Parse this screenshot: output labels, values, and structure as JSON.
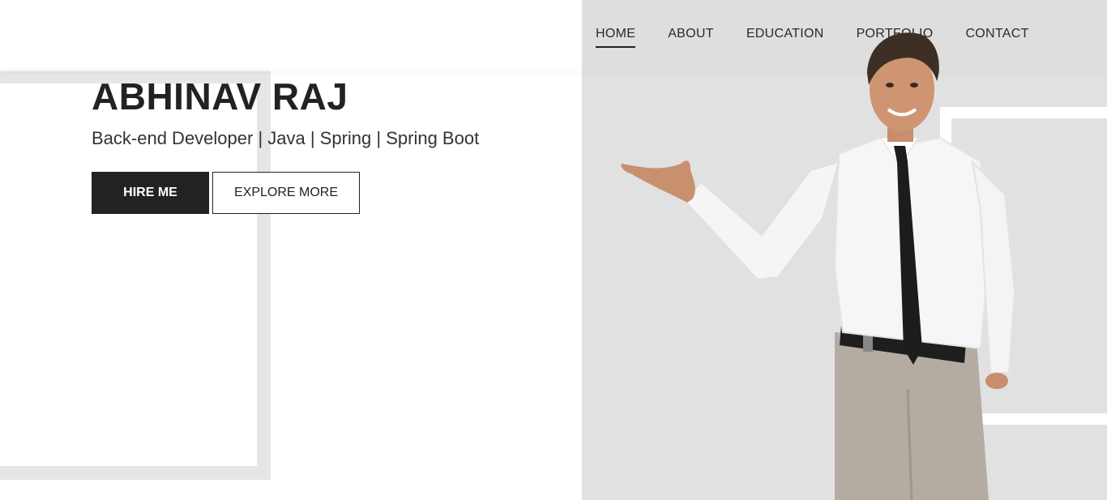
{
  "nav": {
    "items": [
      {
        "label": "HOME",
        "active": true
      },
      {
        "label": "ABOUT",
        "active": false
      },
      {
        "label": "EDUCATION",
        "active": false
      },
      {
        "label": "PORTFOLIO",
        "active": false
      },
      {
        "label": "CONTACT",
        "active": false
      }
    ]
  },
  "hero": {
    "name": "ABHINAV RAJ",
    "subtitle": "Back-end Developer | Java | Spring | Spring Boot",
    "hire_label": "HIRE ME",
    "explore_label": "EXPLORE MORE"
  },
  "colors": {
    "accent": "#222222",
    "panel": "#e1e1e1",
    "background": "#ffffff"
  }
}
